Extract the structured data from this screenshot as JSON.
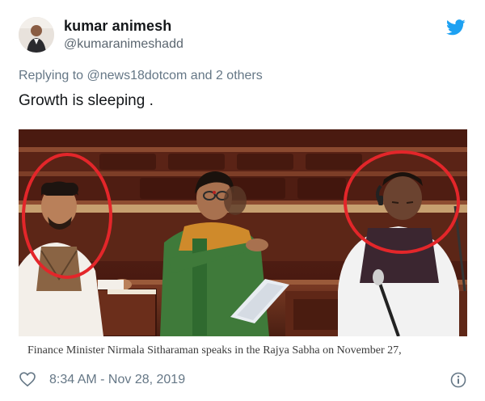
{
  "user": {
    "name": "kumar animesh",
    "handle": "@kumaranimeshadd",
    "avatar_icon": "avatar"
  },
  "reply": {
    "prefix": "Replying to ",
    "mention": "@news18dotcom",
    "suffix": " and 2 others"
  },
  "tweet": {
    "text": "Growth is sleeping ."
  },
  "media": {
    "caption": "Finance Minister Nirmala Sitharaman speaks in the Rajya Sabha on November 27,"
  },
  "footer": {
    "timestamp": "8:34 AM - Nov 28, 2019",
    "like_icon": "heart-icon",
    "info_icon": "info-icon"
  },
  "colors": {
    "twitter_blue": "#1da1f2",
    "circle_red": "#e3262a",
    "muted_text": "#657786"
  }
}
